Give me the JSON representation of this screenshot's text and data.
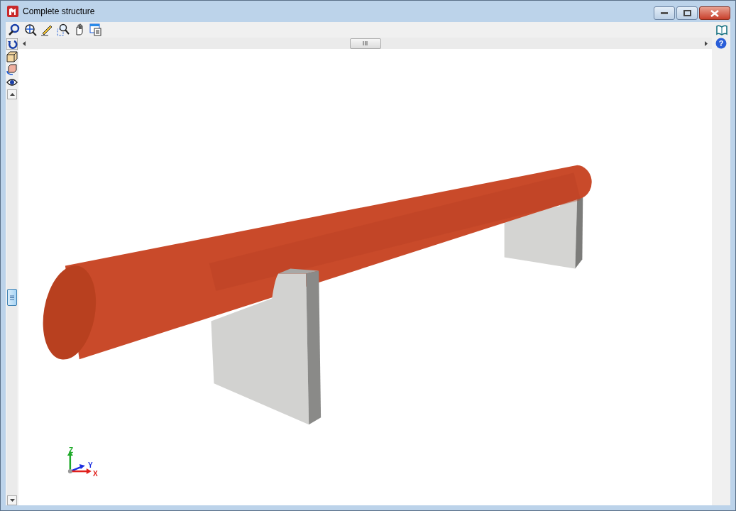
{
  "window": {
    "title": "Complete structure"
  },
  "help_button": {
    "glyph": "?"
  },
  "axes": {
    "labels": [
      {
        "kind": "z",
        "text": "Z"
      },
      {
        "kind": "y",
        "text": "Y"
      },
      {
        "kind": "x",
        "text": "X"
      }
    ]
  }
}
